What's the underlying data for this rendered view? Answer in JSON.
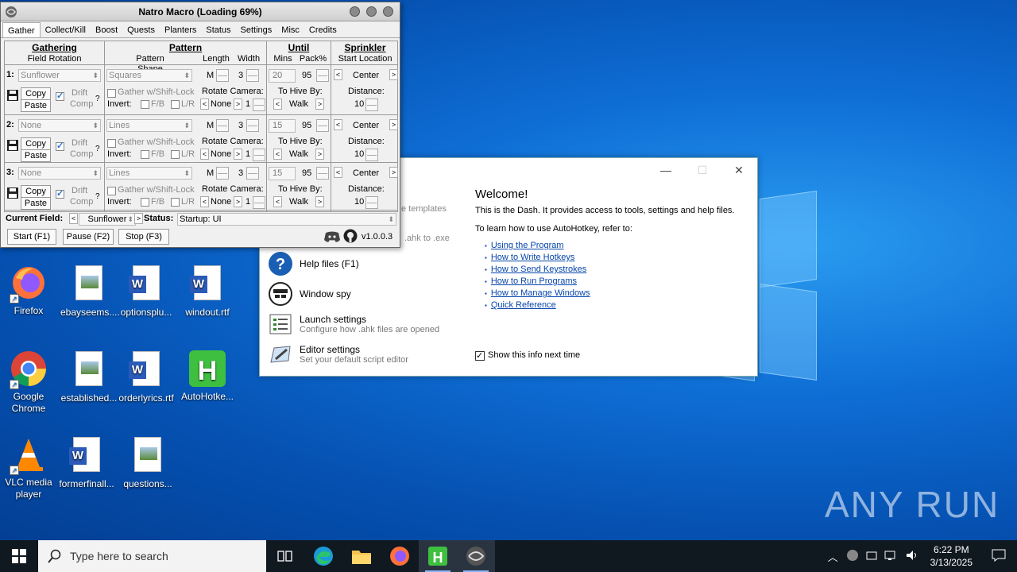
{
  "natro": {
    "title": "Natro Macro (Loading 69%)",
    "tabs": [
      "Gather",
      "Collect/Kill",
      "Boost",
      "Quests",
      "Planters",
      "Status",
      "Settings",
      "Misc",
      "Credits"
    ],
    "headers": {
      "gathering": "Gathering",
      "field_rotation": "Field Rotation",
      "pattern": "Pattern",
      "pattern_shape": "Pattern Shape",
      "length": "Length",
      "width": "Width",
      "until": "Until",
      "mins": "Mins",
      "pack": "Pack%",
      "sprinkler": "Sprinkler",
      "start_location": "Start Location"
    },
    "labels": {
      "copy": "Copy",
      "paste": "Paste",
      "drift": "Drift",
      "comp": "Comp",
      "help": "?",
      "gather_shift": "Gather w/Shift-Lock",
      "invert": "Invert:",
      "fb": "F/B",
      "lr": "L/R",
      "rotate_camera": "Rotate Camera:",
      "to_hive_by": "To Hive By:",
      "distance": "Distance:",
      "m": "M",
      "left": "<",
      "right": ">"
    },
    "rows": [
      {
        "num": "1:",
        "field": "Sunflower",
        "pattern": "Squares",
        "length": "3",
        "mins": "20",
        "pack": "95",
        "location": "Center",
        "rotate": "None",
        "rotate_n": "1",
        "hive": "Walk",
        "distance": "10"
      },
      {
        "num": "2:",
        "field": "None",
        "pattern": "Lines",
        "length": "3",
        "mins": "15",
        "pack": "95",
        "location": "Center",
        "rotate": "None",
        "rotate_n": "1",
        "hive": "Walk",
        "distance": "10"
      },
      {
        "num": "3:",
        "field": "None",
        "pattern": "Lines",
        "length": "3",
        "mins": "15",
        "pack": "95",
        "location": "Center",
        "rotate": "None",
        "rotate_n": "1",
        "hive": "Walk",
        "distance": "10"
      }
    ],
    "current_field_label": "Current Field:",
    "current_field": "Sunflower",
    "status_label": "Status:",
    "status": "Startup: UI",
    "start": "Start (F1)",
    "pause": "Pause (F2)",
    "stop": "Stop (F3)",
    "version": "v1.0.0.3"
  },
  "dash": {
    "behind_text_1": "e templates",
    "behind_text_2": ".ahk to .exe",
    "items": [
      {
        "title": "Help files (F1)",
        "sub": ""
      },
      {
        "title": "Window spy",
        "sub": ""
      },
      {
        "title": "Launch settings",
        "sub": "Configure how .ahk files are opened"
      },
      {
        "title": "Editor settings",
        "sub": "Set your default script editor"
      }
    ],
    "welcome": "Welcome!",
    "intro": "This is the Dash. It provides access to tools, settings and help files.",
    "learn": "To learn how to use AutoHotkey, refer to:",
    "links": [
      "Using the Program",
      "How to Write Hotkeys",
      "How to Send Keystrokes",
      "How to Run Programs",
      "How to Manage Windows",
      "Quick Reference"
    ],
    "show_info": "Show this info next time"
  },
  "desktop": {
    "icons": [
      {
        "label": "Firefox"
      },
      {
        "label": "ebayseems...."
      },
      {
        "label": "optionsplu..."
      },
      {
        "label": "windout.rtf"
      },
      {
        "label": "Google Chrome"
      },
      {
        "label": "established..."
      },
      {
        "label": "orderlyrics.rtf"
      },
      {
        "label": "AutoHotke..."
      },
      {
        "label": "VLC media player"
      },
      {
        "label": "formerfinall..."
      },
      {
        "label": "questions..."
      }
    ],
    "watermark": "ANY RUN"
  },
  "taskbar": {
    "search_placeholder": "Type here to search",
    "time": "6:22 PM",
    "date": "3/13/2025"
  }
}
